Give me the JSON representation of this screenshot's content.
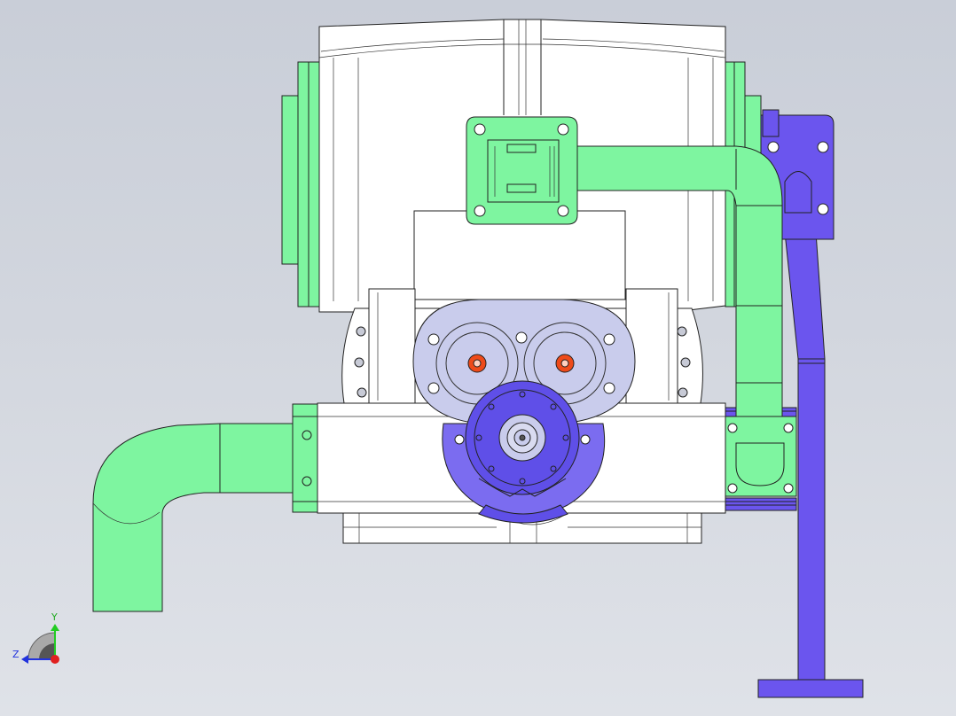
{
  "app": {
    "view": "front",
    "background_colors": [
      "#c9ced8",
      "#dfe2e8"
    ]
  },
  "model": {
    "parts": [
      {
        "name": "gearbox-housing",
        "color": "#ffffff"
      },
      {
        "name": "top-flange-cover",
        "color": "#7ef5a0"
      },
      {
        "name": "side-mounting-plates",
        "color": "#7ef5a0"
      },
      {
        "name": "inlet-pipe-elbow",
        "color": "#7ef5a0"
      },
      {
        "name": "vertical-return-pipe",
        "color": "#7ef5a0"
      },
      {
        "name": "twin-gear-cover",
        "color": "#c9ccec"
      },
      {
        "name": "motor-flange",
        "color": "#5f4fe8"
      },
      {
        "name": "support-leg-bracket",
        "color": "#6b55ee"
      }
    ],
    "accent_colors": {
      "green": "#7ef5a0",
      "blue_violet": "#6b55ee",
      "lavender": "#c9ccec",
      "orange_bolt": "#ee4a1a"
    }
  },
  "triad": {
    "y_label": "Y",
    "z_label": "Z",
    "y_color": "#22cc22",
    "z_color": "#2233dd",
    "origin_color": "#e02020"
  }
}
